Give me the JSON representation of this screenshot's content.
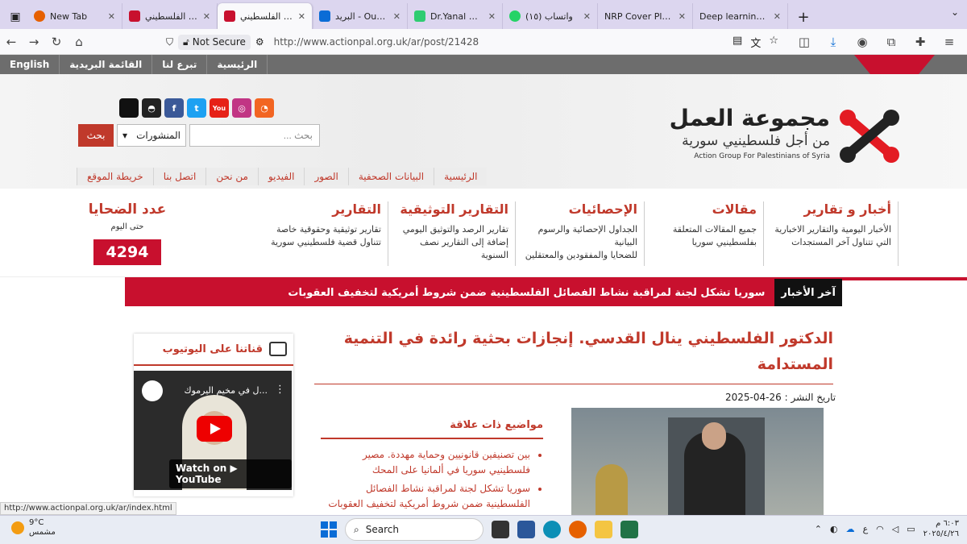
{
  "browser": {
    "tabs": [
      {
        "title": "New Tab",
        "color": "#e66000"
      },
      {
        "title": "الدكتور الفلسطيني",
        "color": "#c8102e"
      },
      {
        "title": "الدكتور الفلسطيني",
        "color": "#c8102e",
        "active": true
      },
      {
        "title": "البريد - Outlook",
        "color": "#0a6cd6"
      },
      {
        "title": "Dr.Yanal Alkuddsi",
        "color": "#2ecc71"
      },
      {
        "title": "واتساب (١٥)",
        "color": "#25d366"
      },
      {
        "title": "NRP Cover Playground",
        "color": "#f4f4f4"
      },
      {
        "title": "Deep learning Model",
        "color": "#f4f4f4"
      }
    ],
    "not_secure": "Not Secure",
    "url": "http://www.actionpal.org.uk/ar/post/21428"
  },
  "topnav": {
    "home": "الرئيسية",
    "donate": "تبرع لنا",
    "mailing": "القائمة البريدية",
    "english": "English"
  },
  "logo": {
    "line1": "مجموعة العمل",
    "line2": "من أجل فلسطينيي سورية",
    "line3": "Action Group For Palestinians of Syria"
  },
  "search": {
    "placeholder": "بحث ...",
    "select_value": "المنشورات",
    "button": "بحث"
  },
  "mainnav": [
    "الرئيسية",
    "البيانات الصحفية",
    "الصور",
    "الفيديو",
    "من نحن",
    "اتصل بنا",
    "خريطة الموقع"
  ],
  "categories": [
    {
      "title": "أخبار و تقارير",
      "desc1": "الأخبار اليومية والتقارير الاخبارية",
      "desc2": "التي تتناول آخر المستجدات"
    },
    {
      "title": "مقالات",
      "desc1": "جميع المقالات المتعلقة",
      "desc2": "بفلسطينيي سوريا"
    },
    {
      "title": "الإحصائيات",
      "desc1": "الجداول الإحصائية والرسوم البيانية",
      "desc2": "للضحايا والمفقودين والمعتقلين"
    },
    {
      "title": "التقارير التوثيقية",
      "desc1": "تقارير الرصد والتوثيق اليومي",
      "desc2": "إضافة إلى التقارير نصف السنوية"
    },
    {
      "title": "التقارير",
      "desc1": "تقارير توثيقية وحقوقية خاصة",
      "desc2": "تتناول قضية فلسطينيي سورية"
    }
  ],
  "victims": {
    "title": "عدد الضحايا",
    "subtitle": "حتى اليوم",
    "count": "4294"
  },
  "ticker": {
    "label": "آخر الأخبار",
    "text": "سوريا تشكل لجنة لمراقبة نشاط الفصائل الفلسطينية ضمن شروط أمريكية لتخفيف العقوبات"
  },
  "youtube": {
    "header": "قناتنا على اليوتيوب",
    "video_title": "...ل في مخيم اليرموك",
    "watch": "Watch on ▶ YouTube"
  },
  "article": {
    "title": "الدكتور الفلسطيني ينال القدسي. إنجازات بحثية رائدة في التنمية المستدامة",
    "date_label": "تاريخ النشر : 26-04-2025"
  },
  "related": {
    "title": "مواضيع ذات علاقة",
    "items": [
      "بين تصنيفين قانونيين وحماية مهددة. مصير فلسطينيي سوريا في ألمانيا على المحك",
      "سوريا تشكل لجنة لمراقبة نشاط الفصائل الفلسطينية ضمن شروط أمريكية لتخفيف العقوبات"
    ]
  },
  "statusbar": "http://www.actionpal.org.uk/ar/index.html",
  "taskbar": {
    "temp": "9°C",
    "weather": "مشمس",
    "search": "Search",
    "time": "٦:٠٣ م",
    "date": "٢٠٢٥/٤/٢٦"
  }
}
